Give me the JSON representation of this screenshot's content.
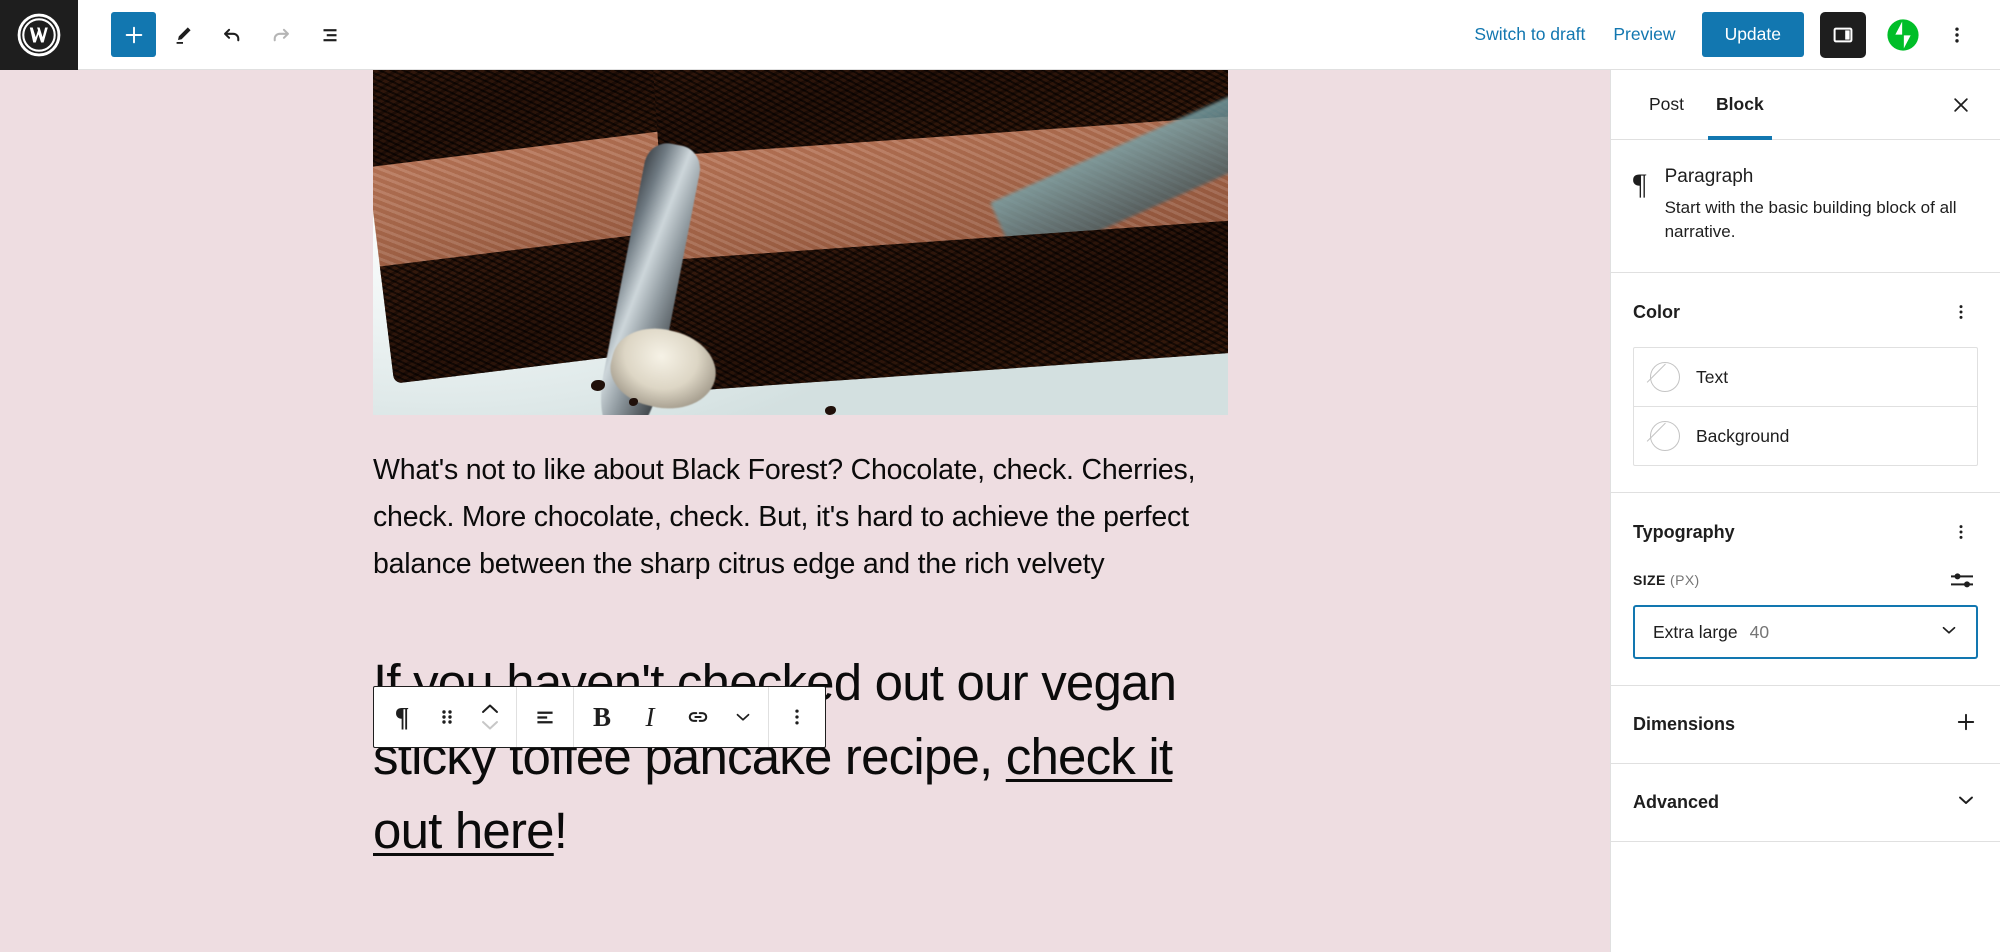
{
  "header": {
    "logo_icon": "wordpress-logo-icon",
    "tools": [
      {
        "name": "add-block",
        "icon": "plus-icon",
        "active": true
      },
      {
        "name": "tools-edit",
        "icon": "pencil-icon",
        "active": false
      },
      {
        "name": "undo",
        "icon": "undo-arrow-icon",
        "active": false
      },
      {
        "name": "redo",
        "icon": "redo-arrow-icon",
        "active": false
      },
      {
        "name": "details",
        "icon": "list-view-icon",
        "active": false
      }
    ],
    "switch_to_draft": "Switch to draft",
    "preview": "Preview",
    "update": "Update",
    "sidebar_toggle_icon": "sidebar-panel-icon",
    "jetpack_icon": "jetpack-icon",
    "more_menu_icon": "vertical-ellipsis-icon",
    "accent_color": "#1277b0",
    "dark_color": "#1e1e1e"
  },
  "canvas": {
    "background_color": "#eedde1",
    "image": {
      "name": "black-forest-cake-photo",
      "alt": "Close-up slices of chocolate Black Forest cake on a white plate with a spoon"
    },
    "paragraph_1": "What's not to like about Black Forest? Chocolate, check. Cherries, check. More chocolate, check. But, it's hard to achieve the perfect balance between the sharp citrus edge and the rich velvety",
    "paragraph_2_before": "If you haven't checked out our vegan sticky toffee pancake recipe, ",
    "paragraph_2_link": "check it out here",
    "paragraph_2_after": "!"
  },
  "block_toolbar": {
    "items": [
      {
        "name": "block-type-paragraph",
        "icon": "pilcrow-icon"
      },
      {
        "name": "drag-handle",
        "icon": "drag-dots-icon"
      },
      {
        "name": "move-up-down",
        "icon": "chevron-up-down-icon"
      },
      {
        "name": "align-text",
        "icon": "align-left-icon"
      },
      {
        "name": "bold",
        "icon": "bold-icon",
        "label": "B"
      },
      {
        "name": "italic",
        "icon": "italic-icon",
        "label": "I"
      },
      {
        "name": "link",
        "icon": "link-icon"
      },
      {
        "name": "more-rich-text",
        "icon": "chevron-down-icon"
      },
      {
        "name": "block-options",
        "icon": "vertical-ellipsis-icon"
      }
    ]
  },
  "sidebar": {
    "tabs": [
      {
        "label": "Post",
        "active": false
      },
      {
        "label": "Block",
        "active": true
      }
    ],
    "close_icon": "close-x-icon",
    "block_card": {
      "icon": "pilcrow-icon",
      "glyph": "¶",
      "title": "Paragraph",
      "description": "Start with the basic building block of all narrative."
    },
    "color_panel": {
      "title": "Color",
      "kebab_icon": "vertical-ellipsis-icon",
      "rows": [
        {
          "label": "Text",
          "swatch": "none"
        },
        {
          "label": "Background",
          "swatch": "none"
        }
      ]
    },
    "typography_panel": {
      "title": "Typography",
      "kebab_icon": "vertical-ellipsis-icon",
      "size_label": "SIZE",
      "size_unit": "(PX)",
      "size_toggle_icon": "sliders-icon",
      "size_value": "Extra large",
      "size_number": "40",
      "chevron_icon": "chevron-down-icon",
      "focus_color": "#1277b0"
    },
    "dimensions_panel": {
      "title": "Dimensions",
      "icon": "plus-icon"
    },
    "advanced_panel": {
      "title": "Advanced",
      "icon": "chevron-down-icon"
    }
  }
}
